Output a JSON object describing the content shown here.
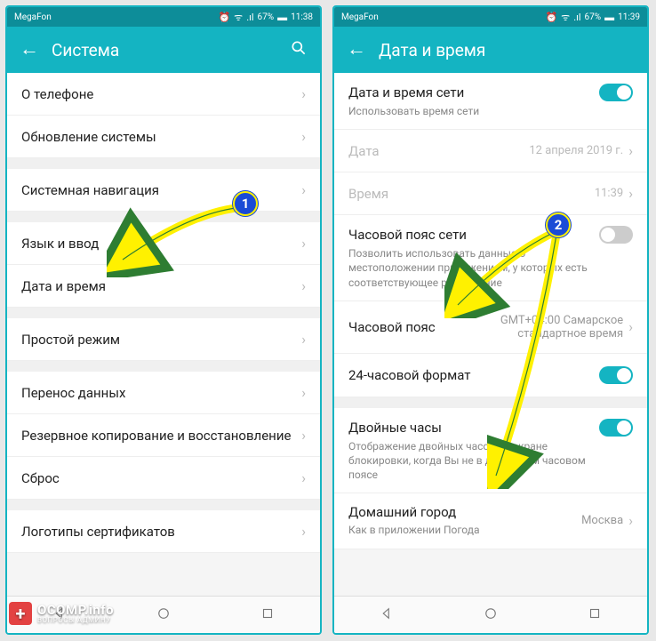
{
  "status": {
    "carrier": "MegaFon",
    "alarm_icon": "⏰",
    "wifi_icon": "ᯤ",
    "signal_icon": "📶",
    "battery_pct_left": "67%",
    "battery_pct_right": "67%",
    "time_left": "11:38",
    "time_right": "11:39"
  },
  "left": {
    "title": "Система",
    "items": {
      "about": "О телефоне",
      "update": "Обновление системы",
      "nav": "Системная навигация",
      "lang": "Язык и ввод",
      "datetime": "Дата и время",
      "simple": "Простой режим",
      "transfer": "Перенос данных",
      "backup": "Резервное копирование и восстановление",
      "reset": "Сброс",
      "certlogos": "Логотипы сертификатов"
    }
  },
  "right": {
    "title": "Дата и время",
    "net_datetime": {
      "title": "Дата и время сети",
      "sub": "Использовать время сети",
      "on": true
    },
    "date": {
      "label": "Дата",
      "value": "12 апреля 2019 г."
    },
    "time": {
      "label": "Время",
      "value": "11:39"
    },
    "net_tz": {
      "title": "Часовой пояс сети",
      "sub": "Позволить использовать данные о местоположении приложениям, у которых есть соответствующее разрешение",
      "on": false
    },
    "tz": {
      "label": "Часовой пояс",
      "value": "GMT+04:00 Самарское стандартное время"
    },
    "h24": {
      "label": "24-часовой формат",
      "on": true
    },
    "dual": {
      "title": "Двойные часы",
      "sub": "Отображение двойных часов на экране блокировки, когда Вы не в домашнем часовом поясе",
      "on": true
    },
    "home": {
      "label": "Домашний город",
      "sub": "Как в приложении Погода",
      "value": "Москва"
    }
  },
  "markers": {
    "m1": "1",
    "m2": "2"
  },
  "watermark": {
    "brand": "OCOMP.info",
    "sub": "ВОПРОСЫ АДМИНУ"
  }
}
